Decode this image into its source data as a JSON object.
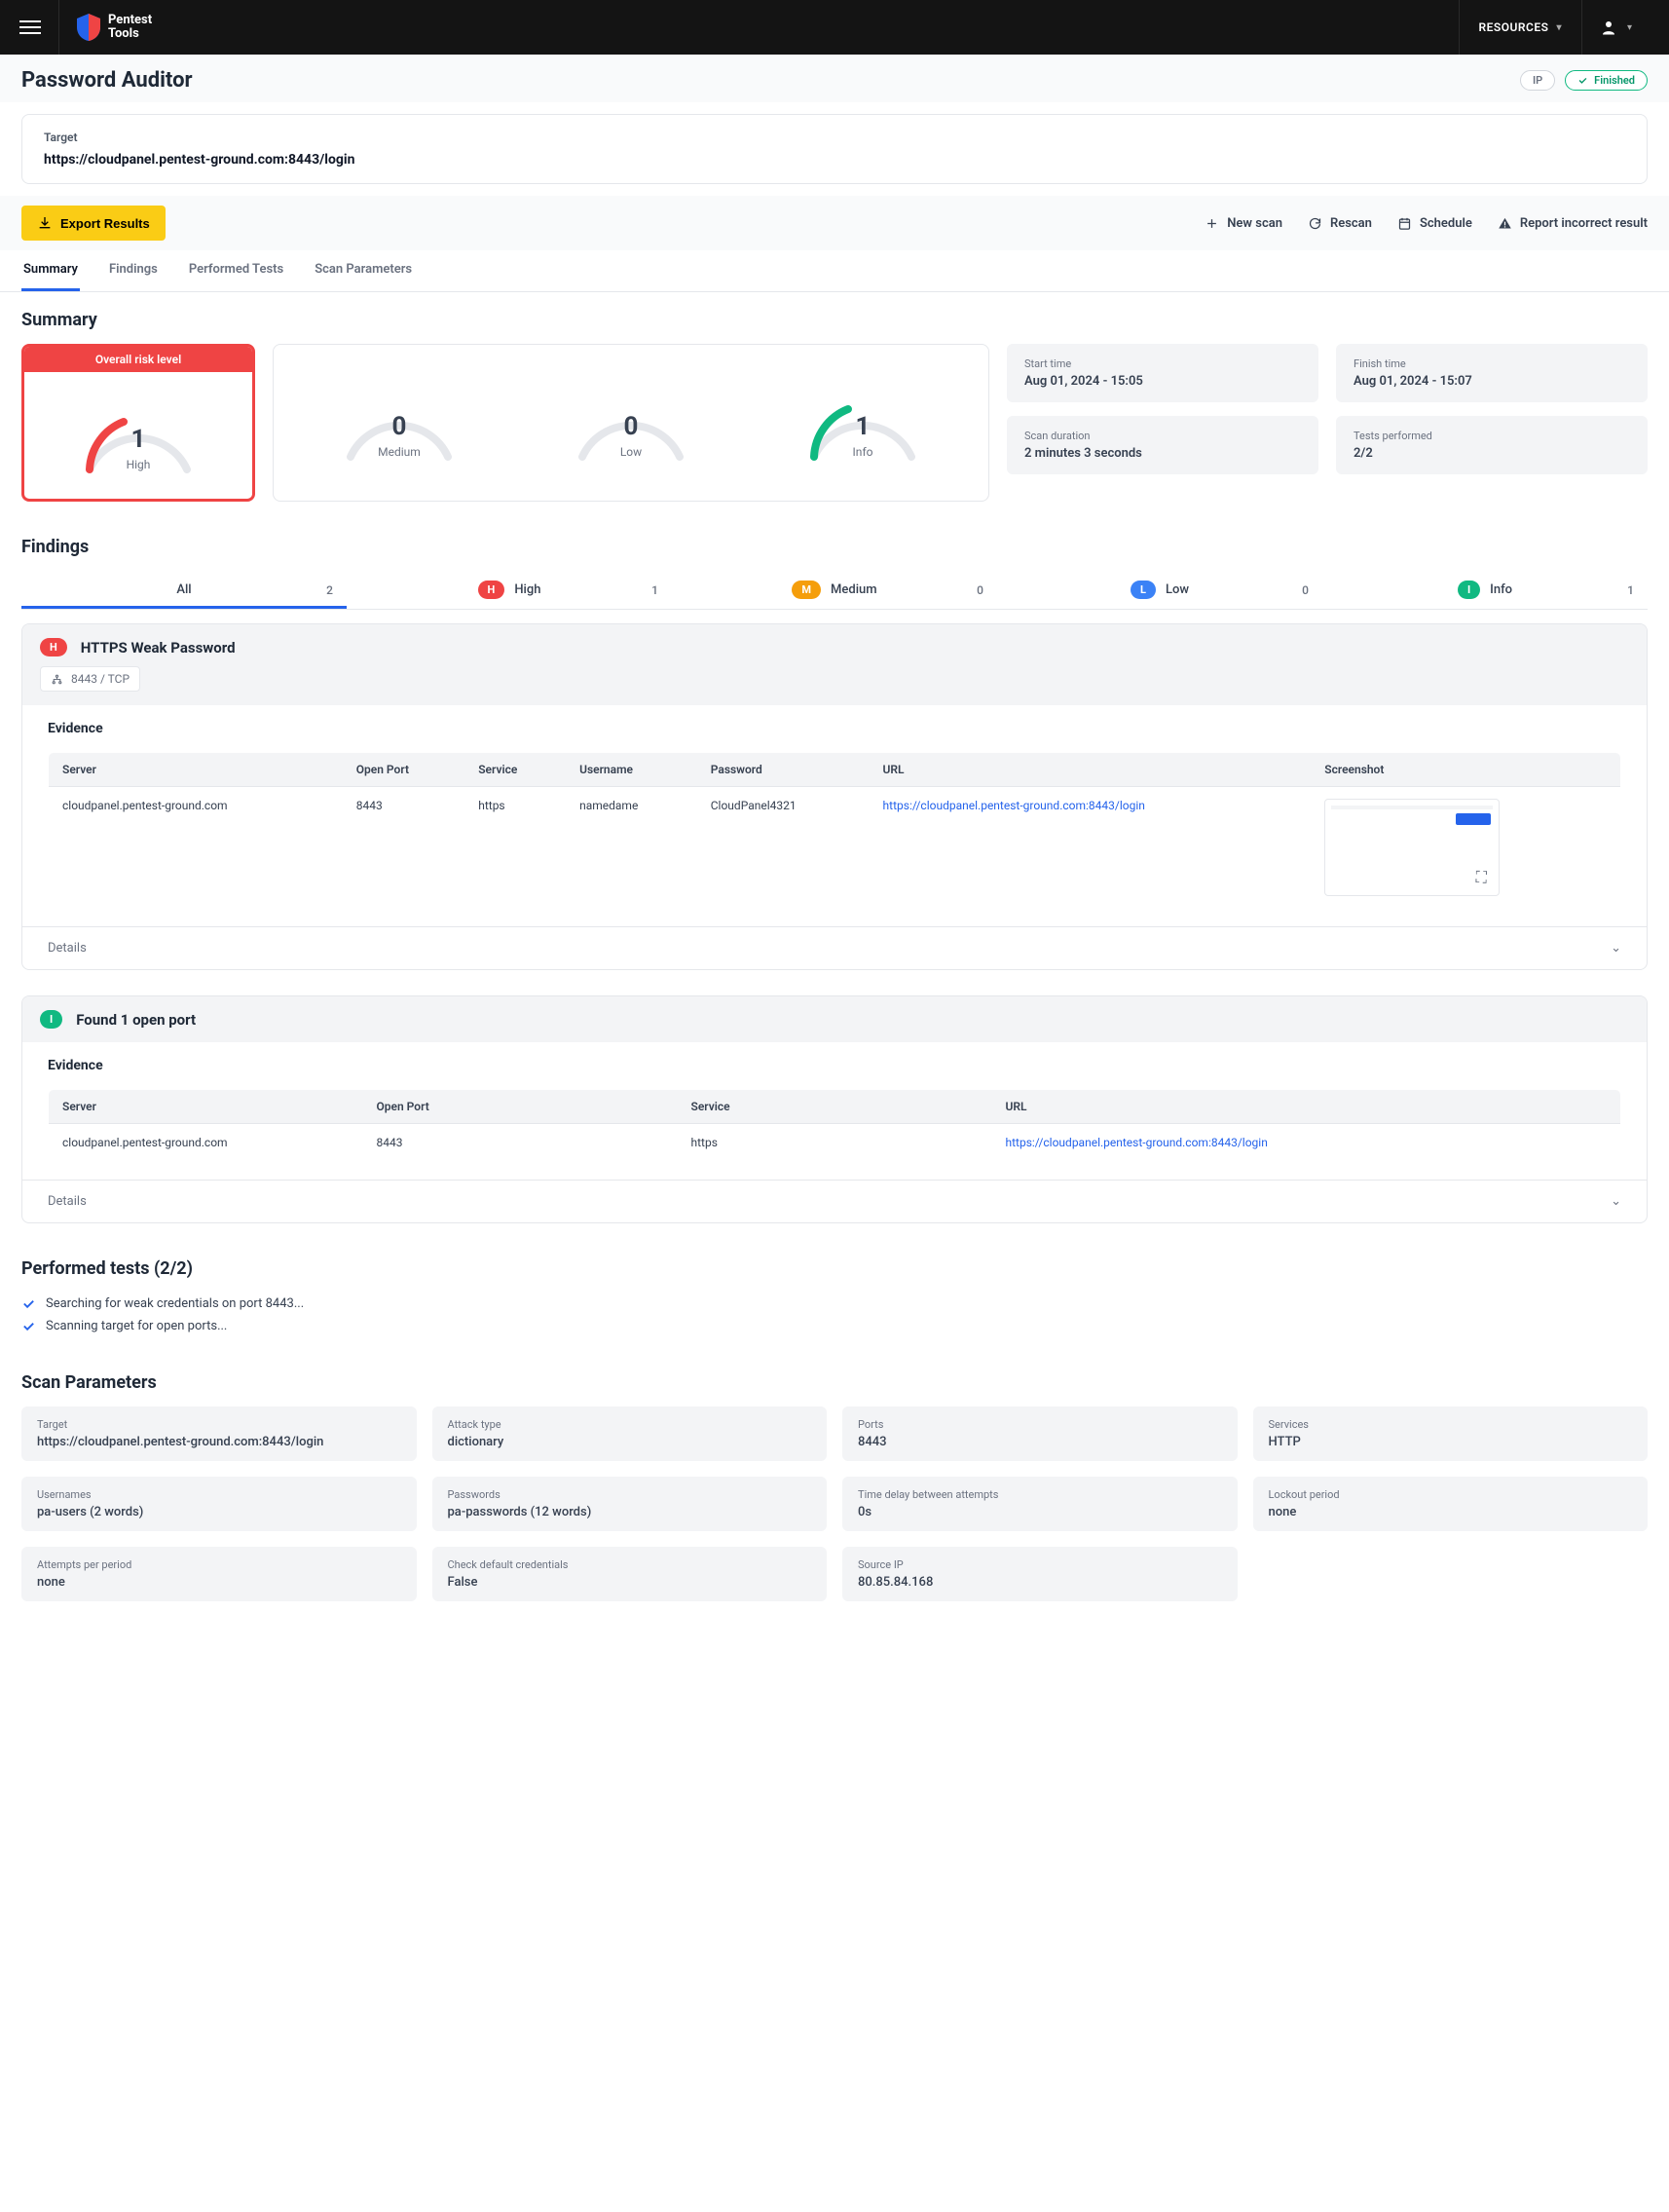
{
  "topbar": {
    "logo_line1": "Pentest",
    "logo_line2": "Tools",
    "resources": "RESOURCES"
  },
  "header": {
    "title": "Password Auditor",
    "ip_badge": "IP",
    "status": "Finished"
  },
  "target": {
    "label": "Target",
    "url": "https://cloudpanel.pentest-ground.com:8443/login"
  },
  "actions": {
    "export": "Export Results",
    "new_scan": "New scan",
    "rescan": "Rescan",
    "schedule": "Schedule",
    "report": "Report incorrect result"
  },
  "tabs": {
    "summary": "Summary",
    "findings": "Findings",
    "performed": "Performed Tests",
    "params": "Scan Parameters"
  },
  "summary": {
    "title": "Summary",
    "risk_label": "Overall risk level",
    "high": {
      "n": "1",
      "l": "High"
    },
    "medium": {
      "n": "0",
      "l": "Medium"
    },
    "low": {
      "n": "0",
      "l": "Low"
    },
    "info": {
      "n": "1",
      "l": "Info"
    },
    "start_k": "Start time",
    "start_v": "Aug 01, 2024 - 15:05",
    "finish_k": "Finish time",
    "finish_v": "Aug 01, 2024 - 15:07",
    "dur_k": "Scan duration",
    "dur_v": "2 minutes 3 seconds",
    "tests_k": "Tests performed",
    "tests_v": "2/2"
  },
  "findings": {
    "title": "Findings",
    "tabs": {
      "all": "All",
      "all_n": "2",
      "high": "High",
      "high_n": "1",
      "medium": "Medium",
      "medium_n": "0",
      "low": "Low",
      "low_n": "0",
      "info": "Info",
      "info_n": "1"
    },
    "evidence_label": "Evidence",
    "details_label": "Details",
    "f1": {
      "title": "HTTPS Weak Password",
      "port_chip": "8443 / TCP",
      "cols": {
        "server": "Server",
        "port": "Open Port",
        "service": "Service",
        "user": "Username",
        "pass": "Password",
        "url": "URL",
        "shot": "Screenshot"
      },
      "row": {
        "server": "cloudpanel.pentest-ground.com",
        "port": "8443",
        "service": "https",
        "user": "namedame",
        "pass": "CloudPanel4321",
        "url": "https://cloudpanel.pentest-ground.com:8443/login"
      }
    },
    "f2": {
      "title": "Found 1 open port",
      "cols": {
        "server": "Server",
        "port": "Open Port",
        "service": "Service",
        "url": "URL"
      },
      "row": {
        "server": "cloudpanel.pentest-ground.com",
        "port": "8443",
        "service": "https",
        "url": "https://cloudpanel.pentest-ground.com:8443/login"
      }
    }
  },
  "performed": {
    "title": "Performed tests (2/2)",
    "t1": "Searching for weak credentials on port 8443...",
    "t2": "Scanning target for open ports..."
  },
  "params": {
    "title": "Scan Parameters",
    "target_k": "Target",
    "target_v": "https://cloudpanel.pentest-ground.com:8443/login",
    "atk_k": "Attack type",
    "atk_v": "dictionary",
    "ports_k": "Ports",
    "ports_v": "8443",
    "svc_k": "Services",
    "svc_v": "HTTP",
    "usr_k": "Usernames",
    "usr_v": "pa-users (2 words)",
    "pwd_k": "Passwords",
    "pwd_v": "pa-passwords (12 words)",
    "delay_k": "Time delay between attempts",
    "delay_v": "0s",
    "lock_k": "Lockout period",
    "lock_v": "none",
    "att_k": "Attempts per period",
    "att_v": "none",
    "def_k": "Check default credentials",
    "def_v": "False",
    "ip_k": "Source IP",
    "ip_v": "80.85.84.168"
  }
}
